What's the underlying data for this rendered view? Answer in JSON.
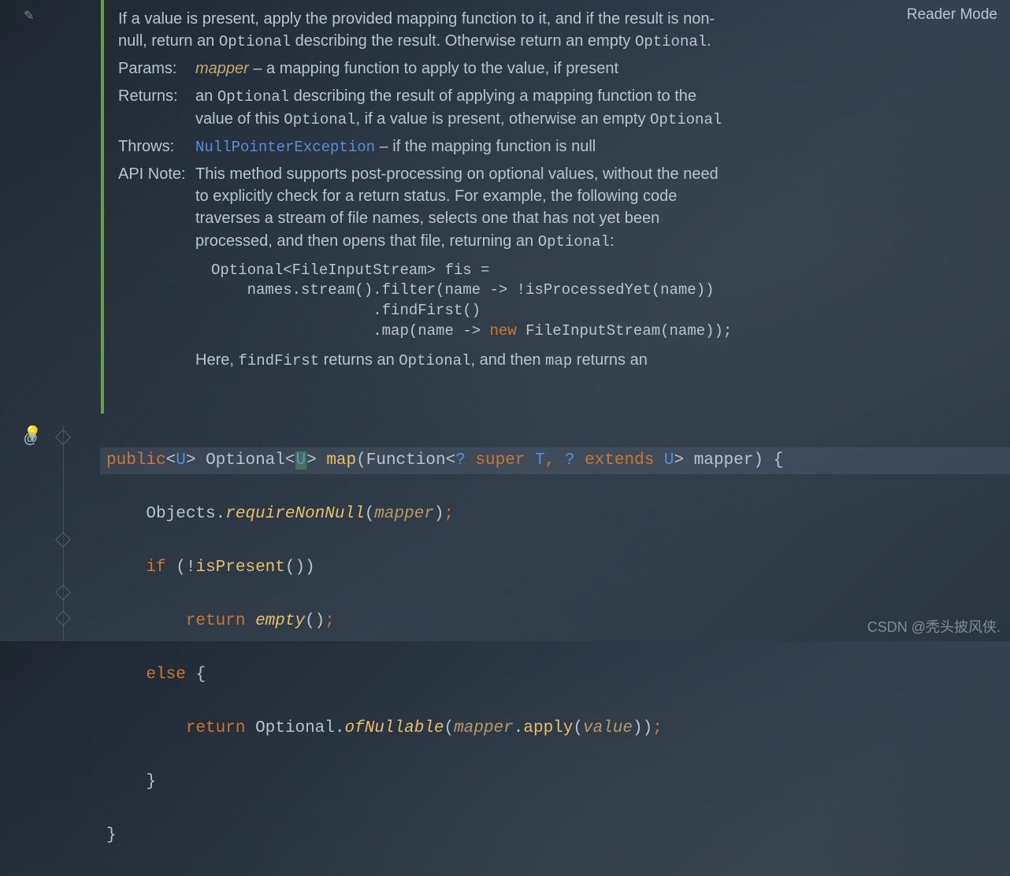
{
  "reader_mode_label": "Reader Mode",
  "doc": {
    "summary_pre": "If a value is present, apply the provided mapping function to it, and if the result is non-null, return an ",
    "summary_code1": "Optional",
    "summary_mid": " describing the result. Otherwise return an empty ",
    "summary_code2": "Optional",
    "summary_end": ".",
    "params_label": "Params:",
    "params_name": "mapper",
    "params_desc": " – a mapping function to apply to the value, if present",
    "returns_label": "Returns:",
    "returns_pre": "an ",
    "returns_code1": "Optional",
    "returns_mid1": " describing the result of applying a mapping function to the value of this ",
    "returns_code2": "Optional",
    "returns_mid2": ", if a value is present, otherwise an empty ",
    "returns_code3": "Optional",
    "throws_label": "Throws:",
    "throws_link": "NullPointerException",
    "throws_desc": " – if the mapping function is null",
    "apinote_label": "API Note:",
    "apinote_body": "This method supports post-processing on optional values, without the need to explicitly check for a return status. For example, the following code traverses a stream of file names, selects one that has not yet been processed, and then opens that file, returning an ",
    "apinote_code": "Optional",
    "apinote_colon": ":",
    "example_l1": "Optional<FileInputStream> fis =",
    "example_l2": "    names.stream().filter(name -> !isProcessedYet(name))",
    "example_l3": "                  .findFirst()",
    "example_l4_pre": "                  .map(name -> ",
    "example_l4_new": "new",
    "example_l4_post": " FileInputStream(name));",
    "trailing_pre": "Here, ",
    "trailing_c1": "findFirst",
    "trailing_mid1": " returns an ",
    "trailing_c2": "Optional",
    "trailing_mid2": ", and then ",
    "trailing_c3": "map",
    "trailing_mid3": " returns an"
  },
  "code": {
    "kw_public": "public",
    "gen_U": "U",
    "type_Optional": "Optional",
    "method_map": "map",
    "type_Function": "Function",
    "q": "?",
    "kw_super": "super",
    "type_T": "T",
    "kw_extends": "extends",
    "param_mapper": "mapper",
    "objects": "Objects",
    "requireNonNull": "requireNonNull",
    "kw_if": "if",
    "isPresent": "isPresent",
    "kw_return": "return",
    "empty_call": "empty",
    "kw_else": "else",
    "ofNullable": "ofNullable",
    "apply": "apply",
    "value": "value"
  },
  "watermark": "CSDN @秃头披风侠."
}
